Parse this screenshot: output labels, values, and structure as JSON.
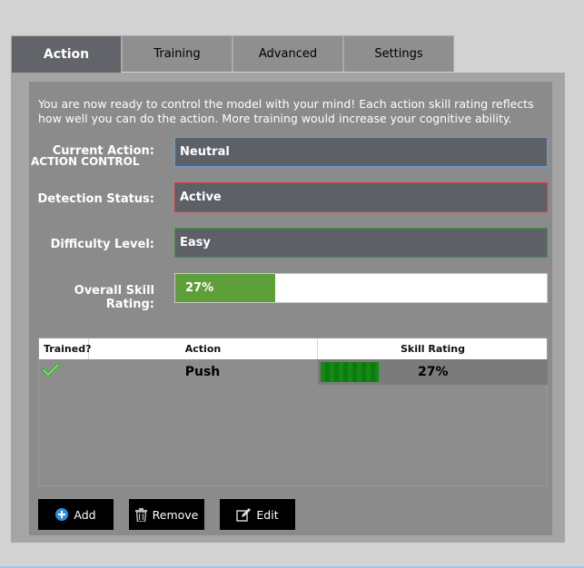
{
  "tabs": [
    {
      "label": "Action",
      "active": true
    },
    {
      "label": "Training",
      "active": false
    },
    {
      "label": "Advanced",
      "active": false
    },
    {
      "label": "Settings",
      "active": false
    }
  ],
  "section": {
    "title": "ACTION CONTROL",
    "description": "You are now ready to control the model with your mind! Each action skill rating reflects how well you can do the action. More training would increase your cognitive ability."
  },
  "fields": {
    "current_action_label": "Current Action:",
    "current_action_value": "Neutral",
    "detection_status_label": "Detection Status:",
    "detection_status_value": "Active",
    "difficulty_label": "Difficulty Level:",
    "difficulty_value": "Easy",
    "overall_skill_label": "Overall Skill Rating:",
    "overall_skill_value": "27%",
    "overall_skill_fraction": 0.27
  },
  "table": {
    "headers": [
      "Trained?",
      "Action",
      "Skill Rating"
    ],
    "rows": [
      {
        "trained": true,
        "action": "Push",
        "skill": "27%",
        "skill_fraction": 0.27
      }
    ]
  },
  "buttons": {
    "add_label": "Add",
    "remove_label": "Remove",
    "edit_label": "Edit"
  },
  "colors": {
    "current_action_border": "#6a9fd4",
    "detection_border": "#d83b3b",
    "difficulty_border": "#3d9a3d",
    "progress_fill": "#5f9f3a",
    "skill_bar": "#138a13"
  },
  "icons": {
    "add": "plus-circle-icon",
    "remove": "trash-icon",
    "edit": "edit-icon",
    "trained": "checkmark-icon"
  }
}
